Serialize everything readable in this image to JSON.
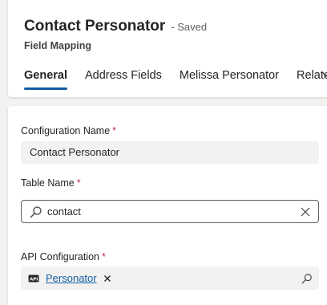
{
  "header": {
    "title": "Contact Personator",
    "save_status": "- Saved",
    "subtitle": "Field Mapping"
  },
  "tabs": [
    {
      "label": "General",
      "active": true
    },
    {
      "label": "Address Fields",
      "active": false
    },
    {
      "label": "Melissa Personator",
      "active": false
    },
    {
      "label": "Related",
      "active": false
    }
  ],
  "form": {
    "configuration_name": {
      "label": "Configuration Name",
      "required_mark": "*",
      "value": "Contact Personator"
    },
    "table_name": {
      "label": "Table Name",
      "required_mark": "*",
      "value": "contact"
    },
    "api_configuration": {
      "label": "API Configuration",
      "required_mark": "*",
      "value": "Personator"
    }
  },
  "colors": {
    "accent": "#115ea3",
    "required": "#c4314b",
    "page_background": "#f3f2f1"
  },
  "icons": {
    "table_search": "search-icon",
    "table_clear": "clear-icon",
    "lookup_entity": "api-entity-icon",
    "lookup_remove": "remove-icon",
    "lookup_search": "search-icon",
    "tabs_overflow": "chevron-down-icon"
  }
}
